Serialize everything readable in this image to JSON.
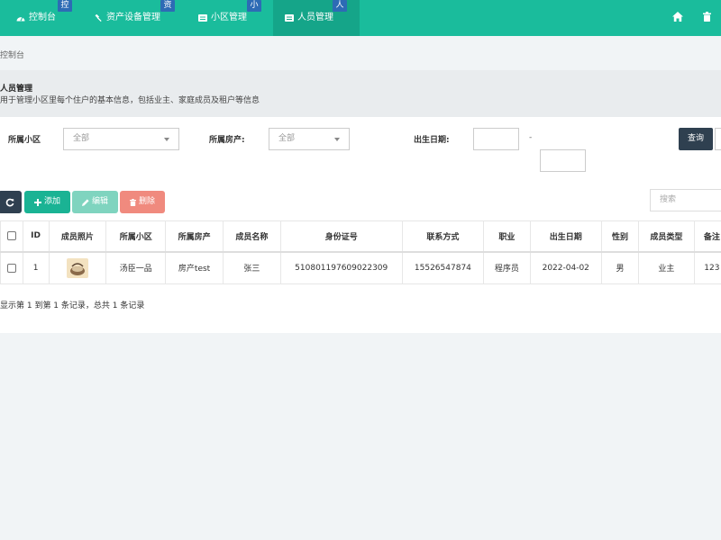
{
  "nav": {
    "tabs": [
      {
        "label": "控制台",
        "badge": "控",
        "icon": "dashboard-icon"
      },
      {
        "label": "资产设备管理",
        "badge": "资",
        "icon": "gavel-icon"
      },
      {
        "label": "小区管理",
        "badge": "小",
        "icon": "list-icon"
      },
      {
        "label": "人员管理",
        "badge": "人",
        "icon": "list-icon",
        "active": true
      }
    ],
    "right_icons": [
      "home-icon",
      "trash-icon"
    ]
  },
  "breadcrumb": "控制台",
  "page": {
    "title": "人员管理",
    "description": "用于管理小区里每个住户的基本信息，包括业主、家庭成员及租户等信息"
  },
  "filters": {
    "community_label": "所属小区",
    "community_value": "全部",
    "property_label": "所属房产:",
    "property_value": "全部",
    "birth_label": "出生日期:",
    "range_separator": "-",
    "query_button": "查询"
  },
  "toolbar": {
    "refresh_icon": "refresh-icon",
    "add_label": "添加",
    "edit_label": "编辑",
    "delete_label": "删除",
    "search_placeholder": "搜索"
  },
  "table": {
    "headers": {
      "id": "ID",
      "photo": "成员照片",
      "community": "所属小区",
      "property": "所属房产",
      "name": "成员名称",
      "id_card": "身份证号",
      "contact": "联系方式",
      "job": "职业",
      "birth": "出生日期",
      "gender": "性别",
      "member_type": "成员类型",
      "note": "备注"
    },
    "rows": [
      {
        "id": "1",
        "community": "汤臣一品",
        "property": "房产test",
        "name": "张三",
        "id_card": "510801197609022309",
        "contact": "15526547874",
        "job": "程序员",
        "birth": "2022-04-02",
        "gender": "男",
        "member_type": "业主",
        "note": "123"
      }
    ]
  },
  "pagination_text": "显示第 1 到第 1 条记录，总共 1 条记录",
  "colors": {
    "nav": "#1abc9c",
    "nav_active": "#15a589",
    "badge": "#2d6bb5",
    "dark_button": "#2f4050",
    "add": "#1ab394",
    "edit": "#7fd4bf",
    "delete": "#f08a7e"
  }
}
